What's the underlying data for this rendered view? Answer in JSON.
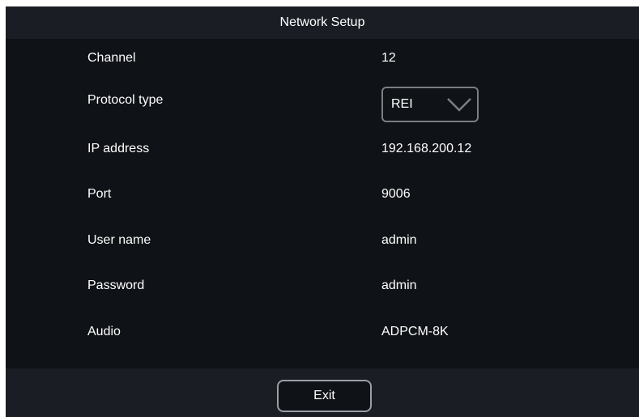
{
  "dialog": {
    "title": "Network Setup",
    "fields": {
      "channel": {
        "label": "Channel",
        "value": "12"
      },
      "protocol": {
        "label": "Protocol type",
        "value": "REI"
      },
      "ip": {
        "label": "IP address",
        "value": "192.168.200.12"
      },
      "port": {
        "label": "Port",
        "value": "9006"
      },
      "username": {
        "label": "User name",
        "value": "admin"
      },
      "password": {
        "label": "Password",
        "value": "admin"
      },
      "audio": {
        "label": "Audio",
        "value": "ADPCM-8K"
      }
    },
    "exit_label": "Exit"
  },
  "colors": {
    "background": "#0f1216",
    "bar": "#1a1e24",
    "text": "#ffffff",
    "border": "#9aa0a6"
  },
  "icons": {
    "dropdown": "chevron-down-icon"
  }
}
